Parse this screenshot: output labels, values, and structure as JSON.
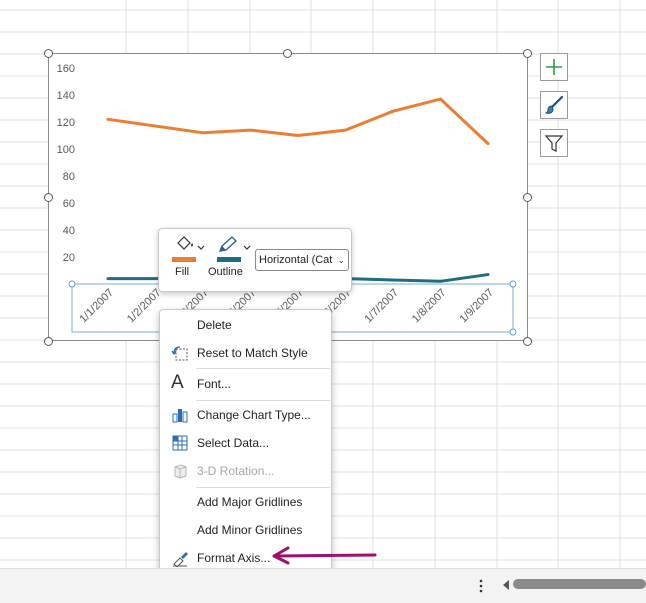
{
  "chart": {
    "y_axis_ticks": [
      "160",
      "140",
      "120",
      "100",
      "80",
      "60",
      "40",
      "20"
    ],
    "x_axis_labels": [
      "1/1/2007",
      "1/2/2007",
      "1/3/2007",
      "1/4/2007",
      "1/5/2007",
      "1/6/2007",
      "1/7/2007",
      "1/8/2007",
      "1/9/2007"
    ]
  },
  "chart_data": {
    "type": "line",
    "x": [
      "1/1/2007",
      "1/2/2007",
      "1/3/2007",
      "1/4/2007",
      "1/5/2007",
      "1/6/2007",
      "1/7/2007",
      "1/8/2007",
      "1/9/2007"
    ],
    "ylim": [
      0,
      160
    ],
    "y_ticks": [
      20,
      40,
      60,
      80,
      100,
      120,
      140,
      160
    ],
    "grid": false,
    "series": [
      {
        "values": [
          122,
          117,
          112,
          114,
          110,
          114,
          128,
          137,
          104
        ],
        "color": "#ED7D31"
      },
      {
        "values": [
          4,
          4,
          5,
          4,
          5,
          4,
          3,
          2,
          7
        ],
        "color": "#1F6C85"
      }
    ]
  },
  "chart_side_buttons": [
    {
      "icon": "plus-icon",
      "purpose": "chart-elements"
    },
    {
      "icon": "paintbrush-icon",
      "purpose": "chart-styles"
    },
    {
      "icon": "funnel-icon",
      "purpose": "chart-filters"
    }
  ],
  "mini_toolbar": {
    "fill_label": "Fill",
    "outline_label": "Outline",
    "element_select_value": "Horizontal (Cat",
    "fill_color": "#ED7D31",
    "outline_color": "#1F6C85"
  },
  "context_menu": {
    "items": [
      {
        "label": "Delete",
        "icon": "none",
        "disabled": false
      },
      {
        "label": "Reset to Match Style",
        "icon": "reset-style-icon",
        "disabled": false
      },
      {
        "label": "Font...",
        "icon": "font-icon",
        "disabled": false
      },
      {
        "label": "Change Chart Type...",
        "icon": "chart-type-icon",
        "disabled": false
      },
      {
        "label": "Select Data...",
        "icon": "select-data-icon",
        "disabled": false
      },
      {
        "label": "3-D Rotation...",
        "icon": "rotation-3d-icon",
        "disabled": true
      },
      {
        "label": "Add Major Gridlines",
        "icon": "none",
        "disabled": false
      },
      {
        "label": "Add Minor Gridlines",
        "icon": "none",
        "disabled": false
      },
      {
        "label": "Format Axis...",
        "icon": "format-axis-icon",
        "disabled": false
      }
    ]
  },
  "annotation": {
    "arrow_color": "#A0106A"
  },
  "status_bar": {
    "more_icon": "more-vertical-icon",
    "scroll_left_icon": "scroll-left-icon"
  }
}
